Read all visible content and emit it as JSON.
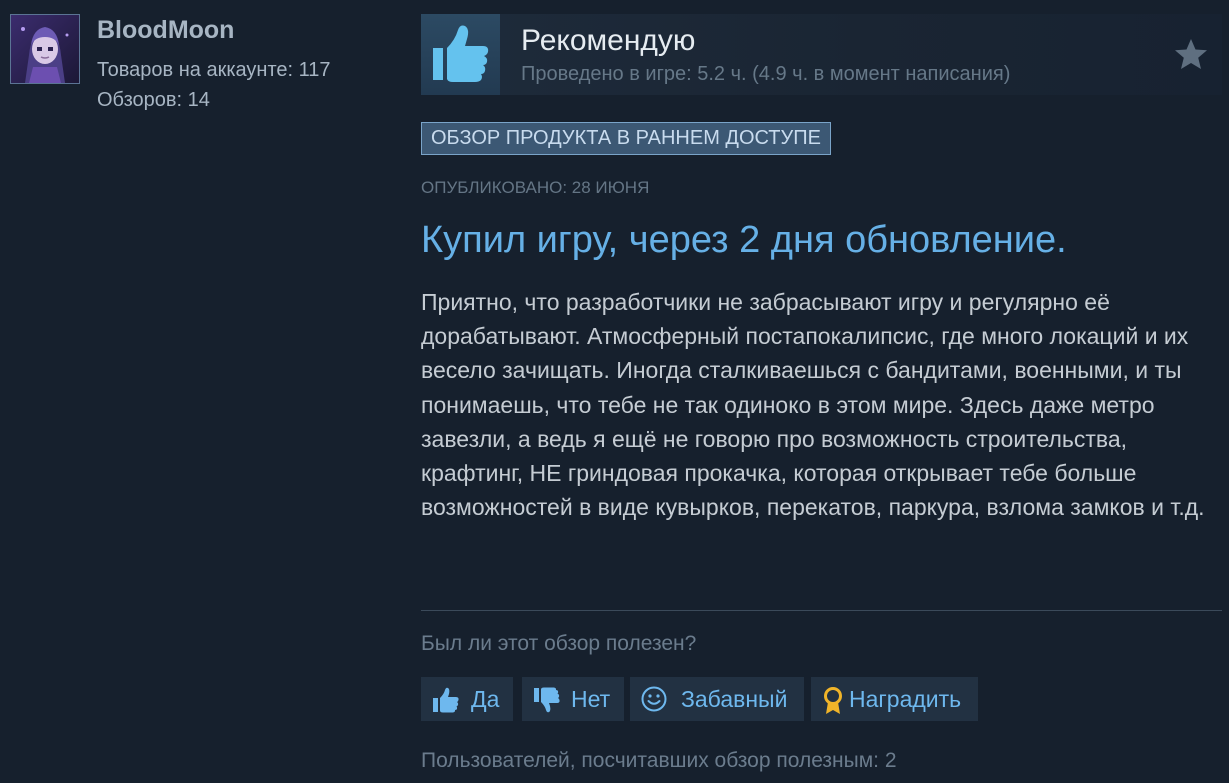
{
  "author": {
    "name": "BloodMoon",
    "items_on_account": "Товаров на аккаунте: 117",
    "reviews_count": "Обзоров: 14"
  },
  "review": {
    "recommendation": "Рекомендую",
    "hours": "Проведено в игре: 5.2 ч. (4.9 ч. в момент написания)",
    "badge": "ОБЗОР ПРОДУКТА В РАННЕМ ДОСТУПЕ",
    "posted": "ОПУБЛИКОВАНО: 28 ИЮНЯ",
    "title": "Купил игру, через 2 дня обновление.",
    "body": "Приятно, что разработчики не забрасывают игру и регулярно её дорабатывают. Атмосферный постапокалипсис, где много локаций и их весело зачищать. Иногда сталкиваешься с бандитами, военными, и ты понимаешь, что тебе не так одиноко в этом мире. Здесь даже метро завезли, а ведь я ещё не говорю про возможность строительства, крафтинг, НЕ гриндовая прокачка, которая открывает тебе больше возможностей в виде кувырков, перекатов, паркура, взлома замков и т.д."
  },
  "feedback": {
    "question": "Был ли этот обзор полезен?",
    "yes": "Да",
    "no": "Нет",
    "funny": "Забавный",
    "award": "Наградить",
    "helpful_count": "Пользователей, посчитавших обзор полезным: 2"
  },
  "icons": {
    "thumbs_up": "thumbs-up-icon",
    "favorite": "star-icon",
    "vote_yes": "thumbs-up-icon",
    "vote_no": "thumbs-down-icon",
    "funny": "smiley-icon",
    "award": "award-ribbon-icon"
  },
  "colors": {
    "background": "#16202d",
    "accent_blue": "#66b0e6",
    "button_bg": "#223142",
    "badge_bg": "#3c5874",
    "award_gold": "#f0b429"
  }
}
